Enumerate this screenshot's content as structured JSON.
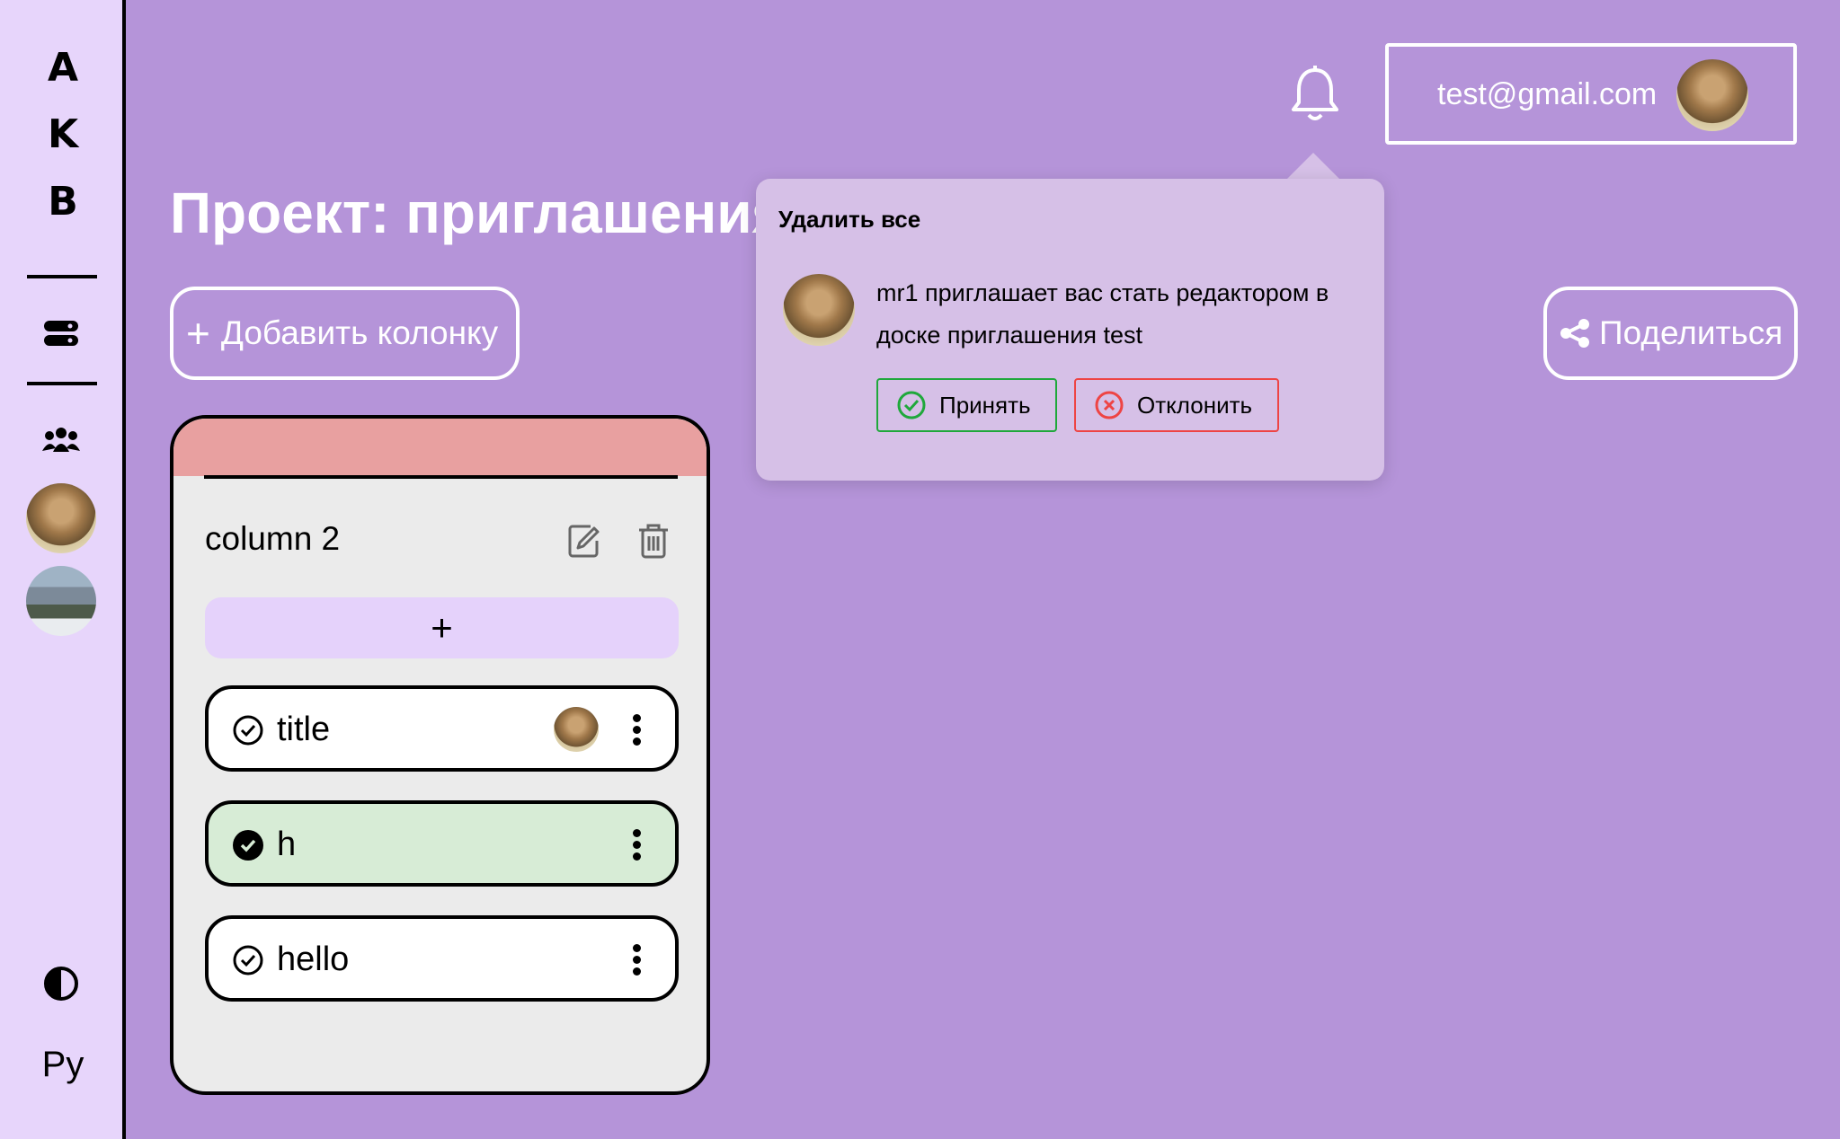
{
  "sidebar": {
    "logo_letters": [
      "A",
      "K",
      "B"
    ],
    "language": "Ру"
  },
  "header": {
    "user_email": "test@gmail.com"
  },
  "page": {
    "title": "Проект: приглашения test",
    "add_column_label": "Добавить колонку",
    "share_label": "Поделиться"
  },
  "column": {
    "title": "column 2",
    "add_task_label": "+",
    "tasks": [
      {
        "title": "title",
        "done": false,
        "has_assignee": true
      },
      {
        "title": "h",
        "done": true,
        "has_assignee": false
      },
      {
        "title": "hello",
        "done": false,
        "has_assignee": false
      }
    ]
  },
  "notifications": {
    "delete_all_label": "Удалить все",
    "items": [
      {
        "message": "mr1 приглашает вас стать редактором в доске приглашения test",
        "accept_label": "Принять",
        "decline_label": "Отклонить"
      }
    ]
  },
  "colors": {
    "background": "#b594d9",
    "sidebar": "#e7d5fb",
    "column_header": "#e8a0a0",
    "task_done": "#d7ecd6",
    "accept": "#1fa83b",
    "decline": "#ee4444"
  }
}
